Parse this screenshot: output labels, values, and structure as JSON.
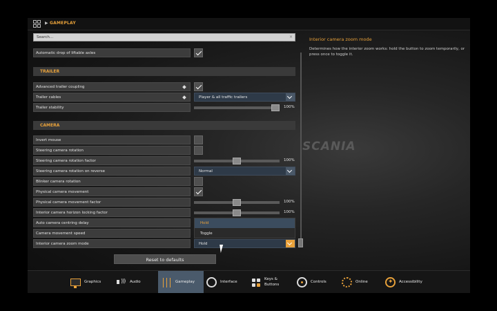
{
  "topbar": {
    "breadcrumb": "GAMEPLAY"
  },
  "search": {
    "placeholder": "Search..."
  },
  "rows": {
    "auto_drop": {
      "label": "Automatic drop of liftable axles",
      "checked": true
    },
    "trailer_section": "TRAILER",
    "adv_coupling": {
      "label": "Advanced trailer coupling",
      "checked": true
    },
    "trailer_cables": {
      "label": "Trailer cables",
      "value": "Player & all traffic trailers"
    },
    "trailer_stability": {
      "label": "Trailer stability",
      "value": "100%",
      "level": 1.0
    },
    "camera_section": "CAMERA",
    "invert_mouse": {
      "label": "Invert mouse",
      "checked": false
    },
    "steer_cam_rot": {
      "label": "Steering camera rotation",
      "checked": false
    },
    "steer_cam_rot_factor": {
      "label": "Steering camera rotation factor",
      "value": "100%",
      "level": 0.5
    },
    "steer_cam_rot_reverse": {
      "label": "Steering camera rotation on reverse",
      "value": "Normal"
    },
    "blinker_cam_rot": {
      "label": "Blinker camera rotation",
      "checked": false
    },
    "physical_cam_move": {
      "label": "Physical camera movement",
      "checked": true
    },
    "physical_cam_factor": {
      "label": "Physical camera movement factor",
      "value": "100%",
      "level": 0.5
    },
    "horizon_lock_factor": {
      "label": "Interior camera horizon locking factor",
      "value": "100%",
      "level": 0.5
    },
    "auto_centring_delay": {
      "label": "Auto camera centring delay"
    },
    "cam_move_speed": {
      "label": "Camera movement speed"
    },
    "zoom_mode": {
      "label": "Interior camera zoom mode",
      "value": "Hold"
    }
  },
  "dropdown_menu": {
    "options": [
      "Hold",
      "Toggle"
    ],
    "selected": "Hold"
  },
  "reset_label": "Reset to defaults",
  "description": {
    "title": "Interior camera zoom mode",
    "text": "Determines how the interior zoom works: hold the button to zoom temporarily, or press once to toggle it."
  },
  "background_brand": "SCANIA",
  "tabs": [
    {
      "label": "Graphics",
      "icon": "monitor-icon",
      "active": false
    },
    {
      "label": "Audio",
      "icon": "speaker-icon",
      "active": false
    },
    {
      "label": "Gameplay",
      "icon": "sliders-icon",
      "active": true
    },
    {
      "label": "Interface",
      "icon": "interface-icon",
      "active": false
    },
    {
      "label": "Keys & Buttons",
      "icon": "keys-icon",
      "active": false
    },
    {
      "label": "Controls",
      "icon": "steering-wheel-icon",
      "active": false
    },
    {
      "label": "Online",
      "icon": "online-icon",
      "active": false
    },
    {
      "label": "Accessibility",
      "icon": "accessibility-icon",
      "active": false
    }
  ],
  "colors": {
    "accent": "#e8a13a",
    "selected_tab": "#4a5a6b",
    "dropdown": "#2e3a48"
  }
}
